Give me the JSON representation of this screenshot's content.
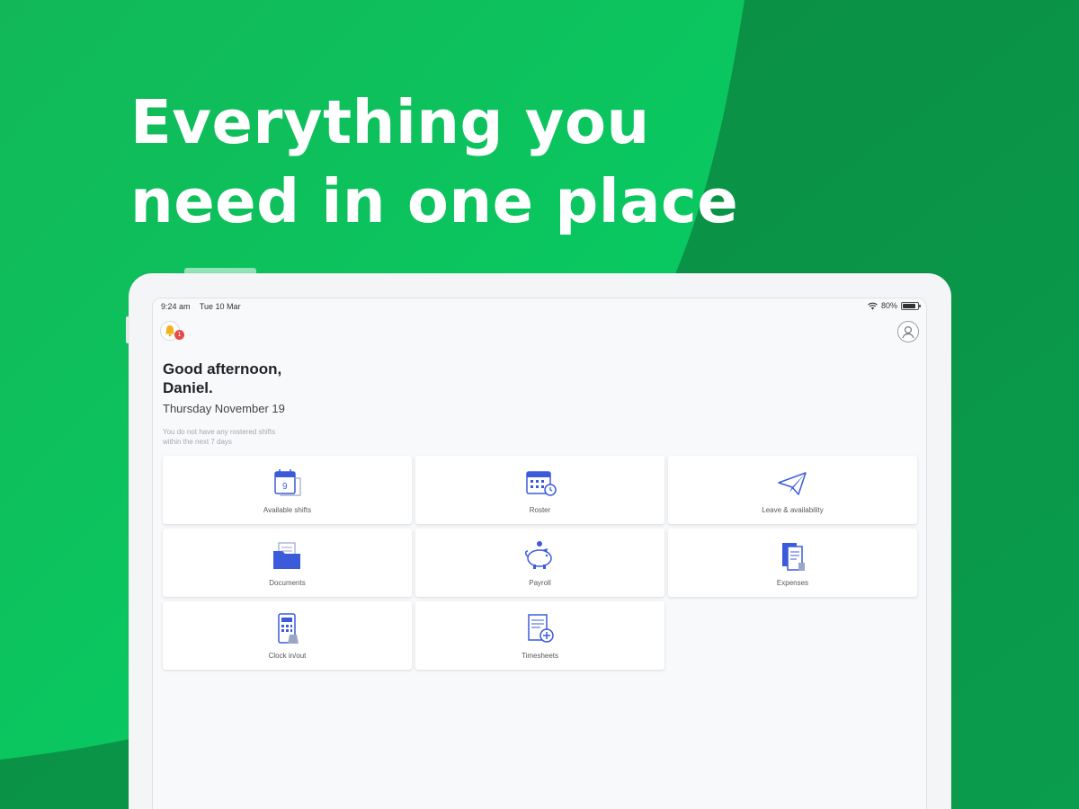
{
  "headline": {
    "line1": "Everything you",
    "line2": "need in one place"
  },
  "colors": {
    "bright_green": "#08c85a",
    "dark_green": "#0a8f45",
    "tile_icon_blue": "#3b5bdb",
    "badge_red": "#e84a4a"
  },
  "statusbar": {
    "time": "9:24 am",
    "date": "Tue 10 Mar",
    "battery": "80%"
  },
  "header": {
    "bell_icon": "bell-icon",
    "badge_count": "1",
    "profile_icon": "profile-icon"
  },
  "greeting": {
    "line1": "Good afternoon,",
    "line2": "Daniel."
  },
  "date_text": "Thursday November 19",
  "notice": {
    "line1": "You do not have any rostered shifts",
    "line2": "within the next 7 days"
  },
  "tiles": [
    {
      "label": "Available shifts",
      "icon": "calendar-page-icon"
    },
    {
      "label": "Roster",
      "icon": "calendar-grid-icon"
    },
    {
      "label": "Leave & availability",
      "icon": "paper-plane-icon"
    },
    {
      "label": "Documents",
      "icon": "folder-icon"
    },
    {
      "label": "Payroll",
      "icon": "piggy-bank-icon"
    },
    {
      "label": "Expenses",
      "icon": "receipts-icon"
    },
    {
      "label": "Clock in/out",
      "icon": "clock-device-icon"
    },
    {
      "label": "Timesheets",
      "icon": "timesheet-icon"
    }
  ]
}
